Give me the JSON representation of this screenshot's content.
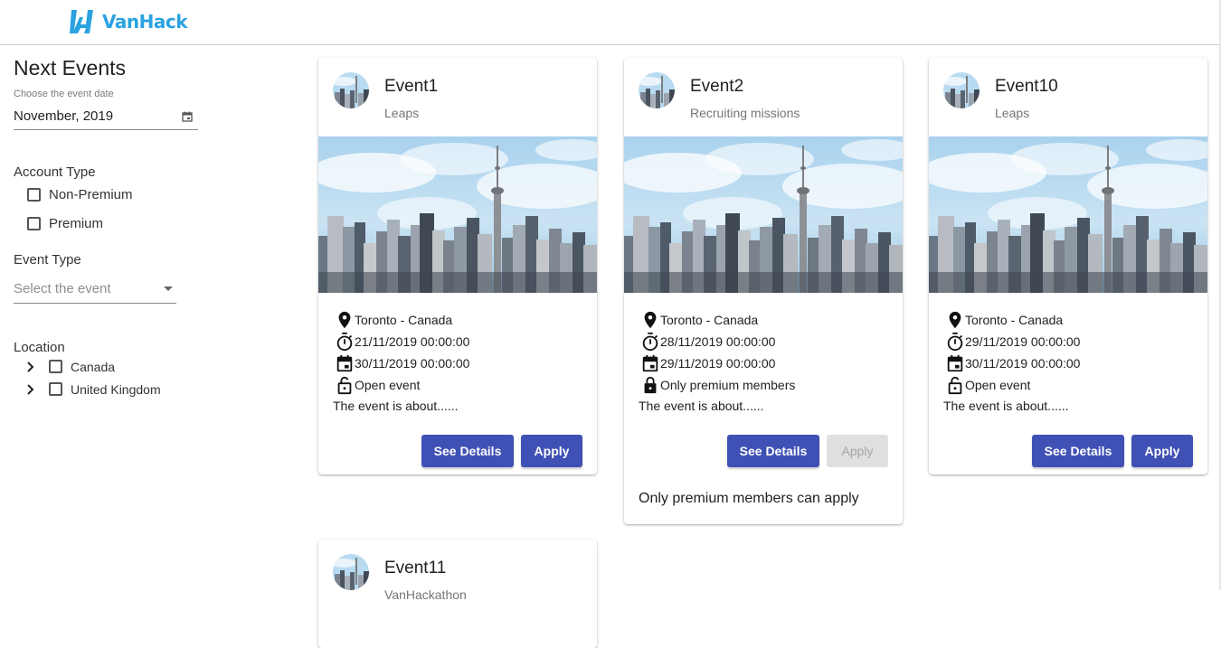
{
  "header": {
    "brand": "VanHack"
  },
  "sidebar": {
    "title": "Next Events",
    "date_label": "Choose the event date",
    "date_value": "November, 2019",
    "account_type_label": "Account Type",
    "account_types": [
      "Non-Premium",
      "Premium"
    ],
    "event_type_label": "Event Type",
    "event_type_placeholder": "Select the event",
    "location_label": "Location",
    "locations": [
      "Canada",
      "United Kingdom"
    ]
  },
  "events": [
    {
      "title": "Event1",
      "subtitle": "Leaps",
      "location": "Toronto - Canada",
      "start": "21/11/2019 00:00:00",
      "end": "30/11/2019 00:00:00",
      "access": "Open event",
      "about": "The event is about......",
      "details_label": "See Details",
      "apply_label": "Apply"
    },
    {
      "title": "Event2",
      "subtitle": "Recruiting missions",
      "location": "Toronto - Canada",
      "start": "28/11/2019 00:00:00",
      "end": "29/11/2019 00:00:00",
      "access": "Only premium members",
      "about": "The event is about......",
      "details_label": "See Details",
      "apply_label": "Apply",
      "note": "Only premium members can apply"
    },
    {
      "title": "Event10",
      "subtitle": "Leaps",
      "location": "Toronto - Canada",
      "start": "29/11/2019 00:00:00",
      "end": "30/11/2019 00:00:00",
      "access": "Open event",
      "about": "The event is about......",
      "details_label": "See Details",
      "apply_label": "Apply"
    },
    {
      "title": "Event11",
      "subtitle": "VanHackathon"
    }
  ],
  "colors": {
    "primary": "#3f51b5",
    "brand": "#2aa2e0",
    "disabled": "#e0e0e0"
  }
}
